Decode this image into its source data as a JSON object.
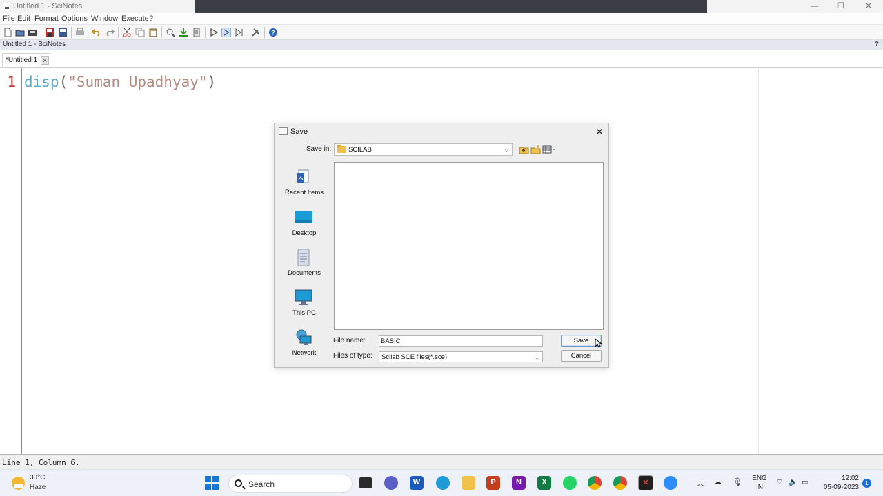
{
  "window": {
    "title": "Untitled 1 - SciNotes",
    "minimize": "—",
    "maximize": "❐",
    "close": "✕"
  },
  "menu": [
    "File",
    "Edit",
    "Format",
    "Options",
    "Window",
    "Execute",
    "?"
  ],
  "panel": {
    "title": "Untitled 1 - SciNotes",
    "help": "?"
  },
  "tab": {
    "label": "*Untitled 1",
    "close": "✕"
  },
  "editor": {
    "line_number": "1",
    "code_fn": "disp",
    "code_open": "(",
    "code_string": "\"Suman Upadhyay\"",
    "code_close": ")"
  },
  "status": {
    "text": "Line 1, Column 6."
  },
  "dialog": {
    "title": "Save",
    "close": "✕",
    "save_in_label": "Save in:",
    "save_in_value": "SCILAB",
    "places": [
      "Recent Items",
      "Desktop",
      "Documents",
      "This PC",
      "Network"
    ],
    "file_name_label": "File name:",
    "file_name_value": "BASIC",
    "file_type_label": "Files of type:",
    "file_type_value": "Scilab SCE files(*.sce)",
    "save_button": "Save",
    "cancel_button": "Cancel"
  },
  "taskbar": {
    "temperature": "30°C",
    "weather": "Haze",
    "search_placeholder": "Search",
    "language_top": "ENG",
    "language_bottom": "IN",
    "time": "12:02",
    "date": "05-09-2023",
    "notifications": "1"
  },
  "colors": {
    "accent_blue": "#1677d6",
    "line_number_red": "#c0392b",
    "keyword_blue": "#5aa9c6",
    "string_brown": "#b48a82"
  }
}
